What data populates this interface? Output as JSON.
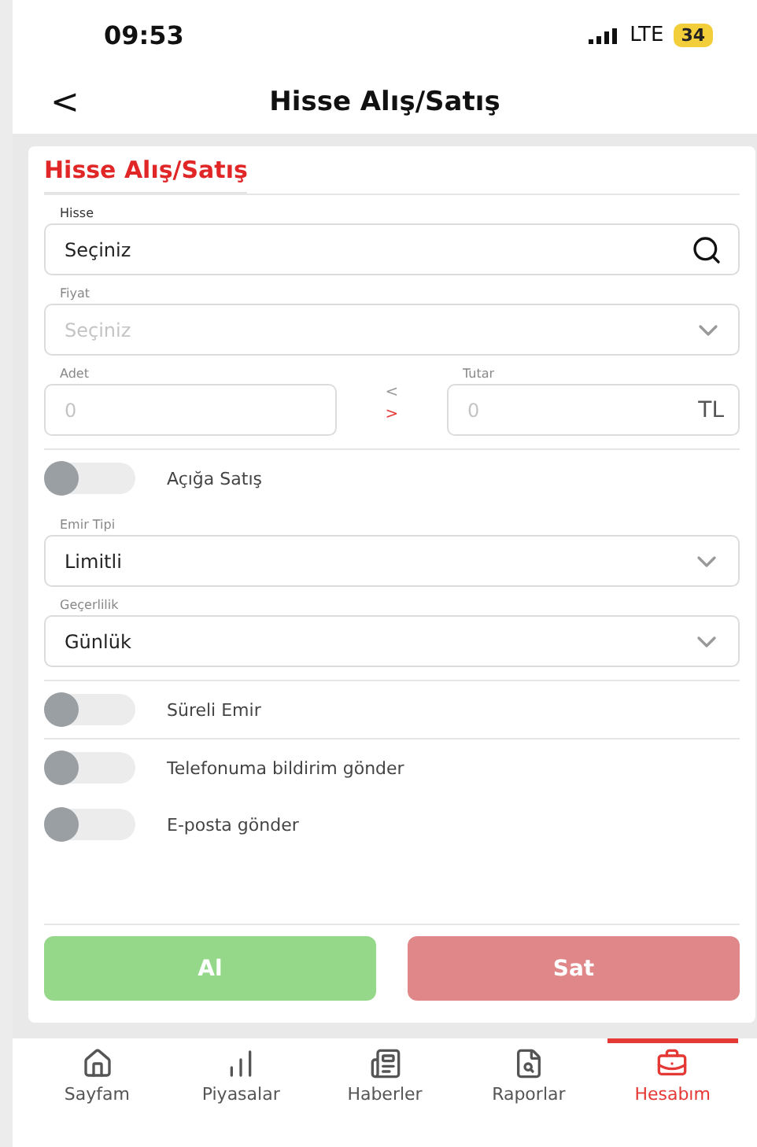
{
  "status_bar": {
    "time": "09:53",
    "network": "LTE",
    "battery": "34"
  },
  "header": {
    "back": "<",
    "title": "Hisse Alış/Satış"
  },
  "card": {
    "title": "Hisse Alış/Satış",
    "stock": {
      "label": "Hisse",
      "value": "Seçiniz"
    },
    "price": {
      "label": "Fiyat",
      "placeholder": "Seçiniz"
    },
    "quantity": {
      "label": "Adet",
      "placeholder": "0"
    },
    "swap": {
      "left": "<",
      "right": ">"
    },
    "amount": {
      "label": "Tutar",
      "placeholder": "0",
      "unit": "TL"
    },
    "short_sale": {
      "label": "Açığa Satış",
      "on": false
    },
    "order_type": {
      "label": "Emir Tipi",
      "value": "Limitli"
    },
    "validity": {
      "label": "Geçerlilik",
      "value": "Günlük"
    },
    "toggles": [
      {
        "label": "Süreli Emir",
        "on": false
      },
      {
        "label": "Telefonuma bildirim gönder",
        "on": false
      },
      {
        "label": "E-posta gönder",
        "on": false
      }
    ],
    "buy": "Al",
    "sell": "Sat"
  },
  "tabs": [
    {
      "label": "Sayfam",
      "selected": false
    },
    {
      "label": "Piyasalar",
      "selected": false
    },
    {
      "label": "Haberler",
      "selected": false
    },
    {
      "label": "Raporlar",
      "selected": false
    },
    {
      "label": "Hesabım",
      "selected": true
    }
  ]
}
